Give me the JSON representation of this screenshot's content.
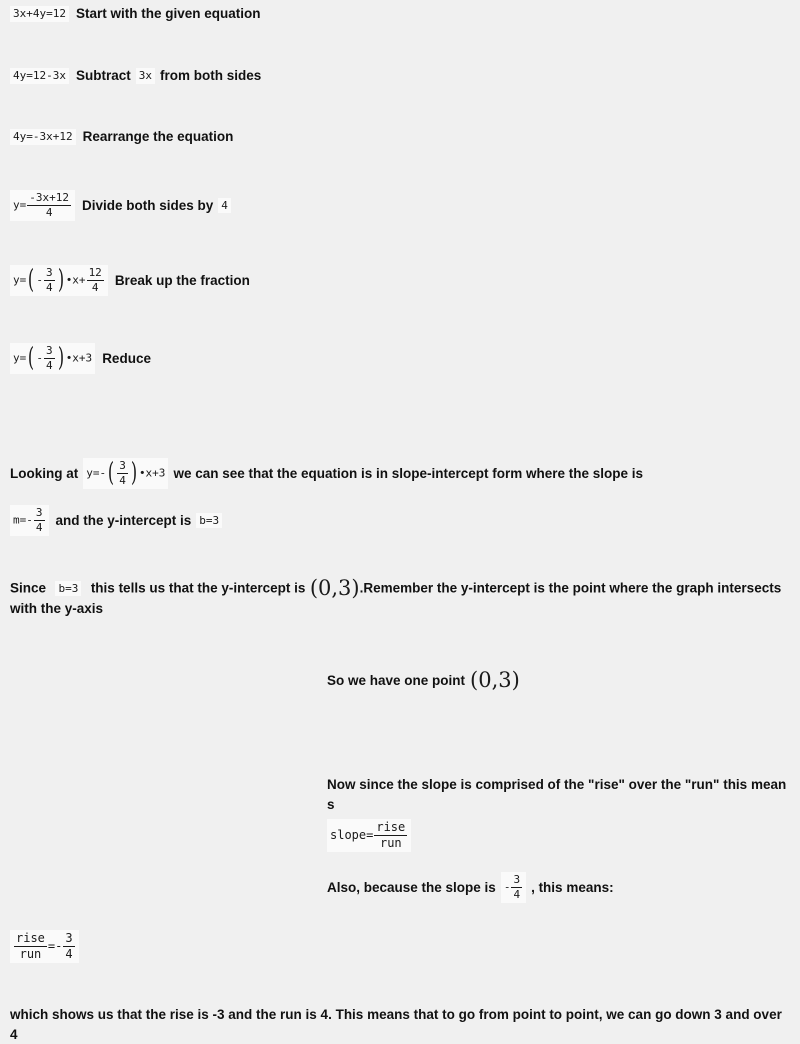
{
  "steps": [
    {
      "equation": "3x+4y=12",
      "label": "Start with the given equation"
    },
    {
      "equation": "4y=12-3x",
      "label_before": "Subtract",
      "inline": "3x",
      "label_after": "from both sides"
    },
    {
      "equation": "4y=-3x+12",
      "label": "Rearrange the equation"
    },
    {
      "numerator": "-3x+12",
      "denominator": "4",
      "lhs": "y=",
      "label_before": "Divide both sides by",
      "inline": "4"
    },
    {
      "lhs": "y=",
      "frac_num": "3",
      "frac_den": "4",
      "sign": "-",
      "mid": "•x+",
      "tail_num": "12",
      "tail_den": "4",
      "label": "Break up the fraction"
    },
    {
      "lhs": "y=",
      "frac_num": "3",
      "frac_den": "4",
      "sign": "-",
      "mid": "•x+3",
      "label": "Reduce"
    }
  ],
  "slope_form": {
    "text_before": "Looking at",
    "equation": {
      "lhs": "y=-",
      "frac_num": "3",
      "frac_den": "4",
      "tail": "•x+3"
    },
    "text_after": "we can see that the equation is in slope-intercept form  where the slope is",
    "slope": {
      "lhs": "m=-",
      "num": "3",
      "den": "4"
    },
    "text_mid": "and the y-intercept is",
    "intercept": "b=3"
  },
  "since_block": {
    "word_since": "Since",
    "intercept": "b=3",
    "text_mid": "this tells us that the y-intercept is",
    "point": "(0,3)",
    "text_after": ".Remember the y-intercept is the point where the graph intersects with the y-axis"
  },
  "one_point": {
    "text": "So we have one point",
    "point": "(0,3)"
  },
  "rise_run": {
    "text": "Now since the slope is comprised of the \"rise\" over the \"run\" this means",
    "formula": {
      "lhs": "slope=",
      "num": "rise",
      "den": "run"
    }
  },
  "also_block": {
    "text_before": "Also, because the slope is",
    "sign": "-",
    "num": "3",
    "den": "4",
    "text_after": ", this means:"
  },
  "ratio": {
    "num": "rise",
    "den": "run",
    "eq": "=-",
    "val_num": "3",
    "val_den": "4"
  },
  "conclusion": {
    "text": "which shows us that the rise is -3 and the run is 4. This means that to go from point to point, we can go down 3 and over 4"
  }
}
